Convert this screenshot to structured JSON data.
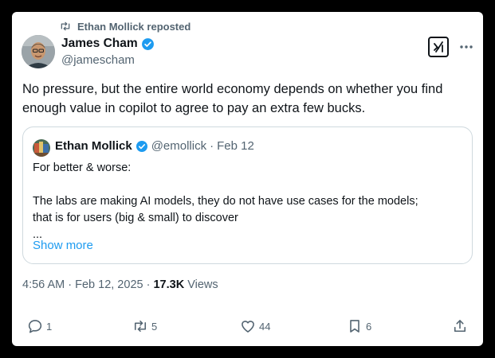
{
  "repost": {
    "label": "Ethan Mollick reposted",
    "icon": "repost-icon"
  },
  "tweet": {
    "author_name": "James Cham",
    "author_handle": "@jamescham",
    "verified_icon": "verified-badge-icon",
    "text": "No pressure, but the entire world economy depends on whether you find enough value in copilot to agree to pay an extra few bucks.",
    "time": "4:56 AM",
    "date": "Feb 12, 2025",
    "separator": "·",
    "views_count": "17.3K",
    "views_label": "Views",
    "header_icons": [
      "grok-icon",
      "more-icon"
    ]
  },
  "quote": {
    "author_name": "Ethan Mollick",
    "author_handle": "@emollick",
    "separator": "·",
    "date": "Feb 12",
    "lines": [
      "For better & worse:",
      "",
      "The labs are making AI models, they do not have use cases for the models;",
      "that is for users (big & small) to discover",
      "..."
    ],
    "show_more": "Show more"
  },
  "actions": {
    "reply": {
      "icon": "reply-icon",
      "count": "1"
    },
    "repost": {
      "icon": "repost-icon",
      "count": "5"
    },
    "like": {
      "icon": "like-icon",
      "count": "44"
    },
    "bookmark": {
      "icon": "bookmark-icon",
      "count": "6"
    },
    "share": {
      "icon": "share-icon"
    }
  },
  "colors": {
    "background": "#000000",
    "card": "#ffffff",
    "text_primary": "#0f1419",
    "text_secondary": "#536471",
    "link": "#1d9bf0",
    "verified": "#1d9bf0",
    "border": "#cfd9de"
  }
}
